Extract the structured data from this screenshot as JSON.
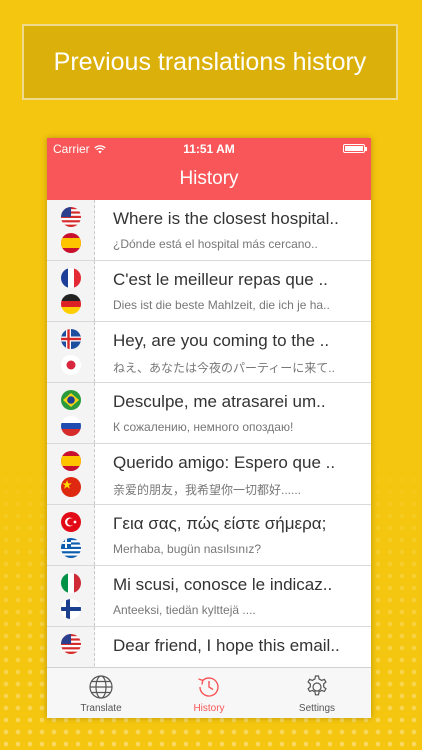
{
  "banner": {
    "text": "Previous translations history"
  },
  "status": {
    "carrier": "Carrier",
    "time": "11:51 AM"
  },
  "header": {
    "title": "History"
  },
  "rows": [
    {
      "main": "Where is the closest hospital..",
      "sub": "¿Dónde está el hospital más cercano..",
      "from": "us",
      "to": "es"
    },
    {
      "main": "C'est le meilleur repas que ..",
      "sub": "Dies ist die beste Mahlzeit, die ich je ha..",
      "from": "fr",
      "to": "de"
    },
    {
      "main": "Hey, are you coming to the ..",
      "sub": "ねえ、あなたは今夜のパーティーに来て..",
      "from": "is",
      "to": "jp"
    },
    {
      "main": "Desculpe, me atrasarei um..",
      "sub": "К сожалению, немного опоздаю!",
      "from": "br",
      "to": "ru"
    },
    {
      "main": "Querido amigo: Espero que ..",
      "sub": "亲爱的朋友，我希望你一切都好......",
      "from": "es",
      "to": "cn"
    },
    {
      "main": "Γεια σας, πώς είστε σήμερα;",
      "sub": "Merhaba, bugün nasılsınız?",
      "from": "tr",
      "to": "gr"
    },
    {
      "main": "Mi scusi, conosce le indicaz..",
      "sub": "Anteeksi, tiedän kylttejä ....",
      "from": "it",
      "to": "fi"
    },
    {
      "main": "Dear friend, I hope this email..",
      "sub": "",
      "from": "us",
      "to": ""
    }
  ],
  "tabs": [
    {
      "label": "Translate",
      "icon": "globe-icon",
      "active": false
    },
    {
      "label": "History",
      "icon": "history-icon",
      "active": true
    },
    {
      "label": "Settings",
      "icon": "gear-icon",
      "active": false
    }
  ],
  "colors": {
    "accent": "#f85658",
    "background": "#f5c60f"
  }
}
